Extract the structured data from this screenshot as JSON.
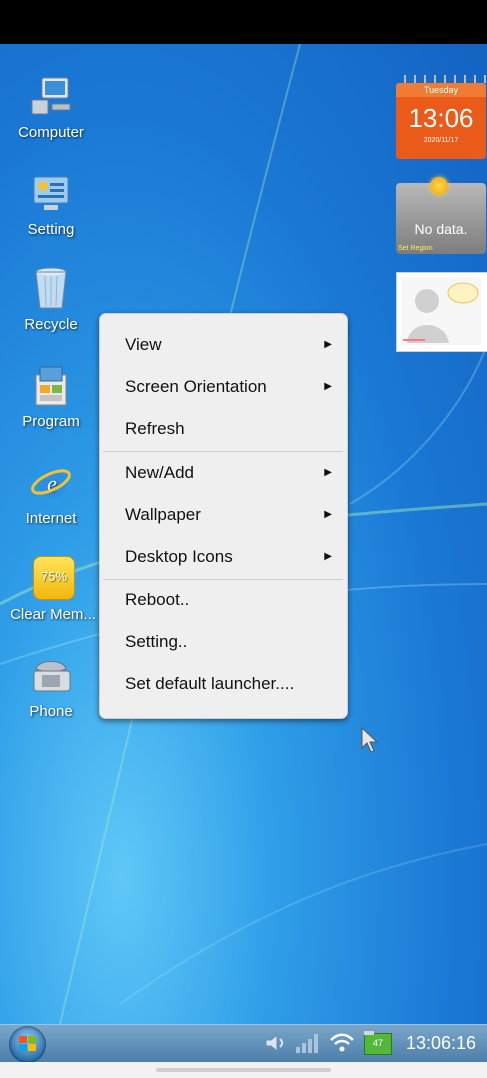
{
  "desktop_icons": [
    {
      "label": "Computer"
    },
    {
      "label": "Setting"
    },
    {
      "label": "Recycle"
    },
    {
      "label": "Program"
    },
    {
      "label": "Internet"
    },
    {
      "label": "Clear Mem...",
      "badge": "75%"
    },
    {
      "label": "Phone"
    }
  ],
  "widgets": {
    "clock": {
      "day": "Tuesday",
      "time": "13:06",
      "date": "2020/11/17"
    },
    "weather": {
      "status": "No data.",
      "region_link": "Set Region"
    }
  },
  "context_menu": {
    "items": [
      {
        "label": "View",
        "submenu": true
      },
      {
        "label": "Screen Orientation",
        "submenu": true
      },
      {
        "label": "Refresh",
        "submenu": false
      },
      {
        "label": "New/Add",
        "submenu": true
      },
      {
        "label": "Wallpaper",
        "submenu": true
      },
      {
        "label": "Desktop Icons",
        "submenu": true
      },
      {
        "label": "Reboot..",
        "submenu": false
      },
      {
        "label": "Setting..",
        "submenu": false
      },
      {
        "label": "Set default launcher....",
        "submenu": false
      }
    ]
  },
  "taskbar": {
    "time": "13:06:16",
    "battery_level": "47"
  },
  "colors": {
    "desktop": "#1a78d4",
    "clock_widget": "#ea5b19",
    "menu_bg": "#efefef",
    "taskbar": "#4b7ea9"
  }
}
